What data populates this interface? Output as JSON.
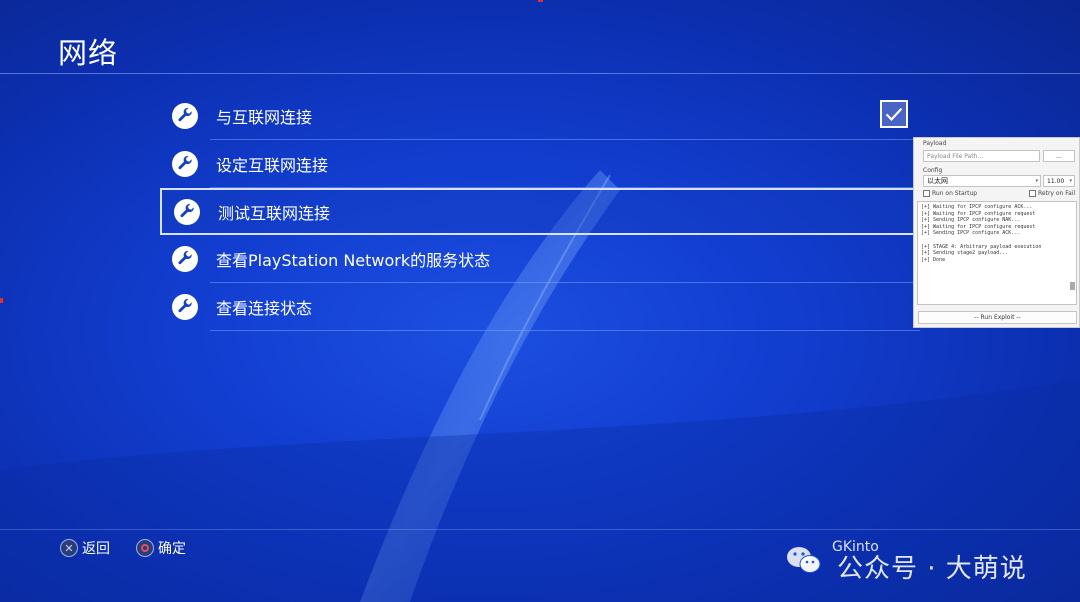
{
  "header": {
    "title": "网络"
  },
  "menu": {
    "items": [
      {
        "label": "与互联网连接",
        "checked": true
      },
      {
        "label": "设定互联网连接"
      },
      {
        "label": "测试互联网连接",
        "selected": true
      },
      {
        "label": "查看PlayStation Network的服务状态"
      },
      {
        "label": "查看连接状态"
      }
    ]
  },
  "footer": {
    "back_label": "返回",
    "confirm_label": "确定"
  },
  "overlay": {
    "payload_label": "Payload",
    "payload_placeholder": "Payload File Path...",
    "browse_label": "...",
    "config_label": "Config",
    "interface_value": "以太网",
    "version_value": "11.00",
    "run_on_startup_label": "Run on Startup",
    "retry_on_fail_label": "Retry on Fail",
    "log_lines": [
      "[+] Waiting for IPCP configure ACK...",
      "[+] Waiting for IPCP configure request",
      "[+] Sending IPCP configure NAK...",
      "[+] Waiting for IPCP configure request",
      "[+] Sending IPCP configure ACK...",
      "",
      "[+] STAGE 4: Arbitrary payload execution",
      "[+] Sending stage2 payload...",
      "[+] Done"
    ],
    "run_button_label": "-- Run Exploit --"
  },
  "watermark": {
    "author": "GKinto",
    "text": "公众号 · 大萌说"
  },
  "colors": {
    "background": "#123ed0",
    "selection_border": "#e1ebff",
    "circle_button": "#e25060"
  }
}
